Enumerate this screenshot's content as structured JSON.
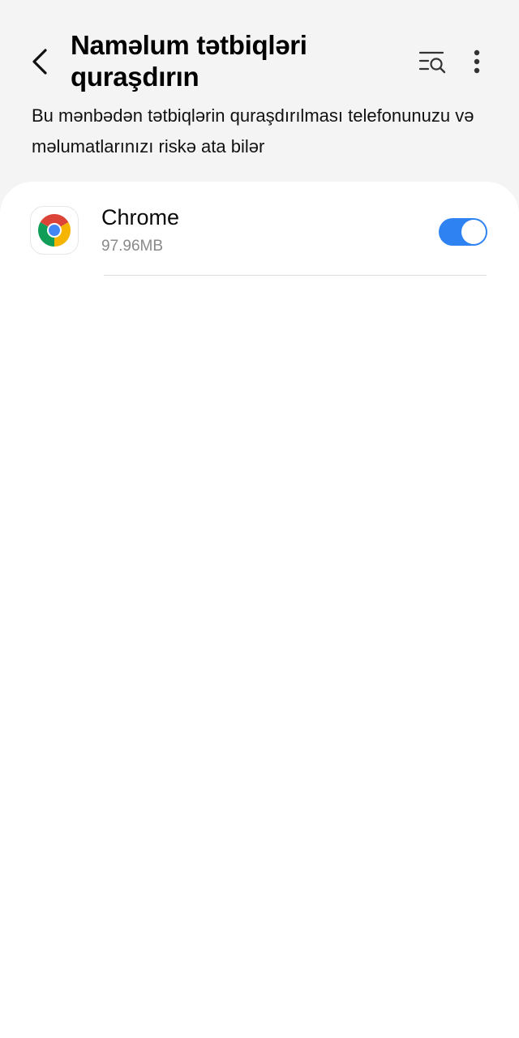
{
  "header": {
    "title": "Naməlum tətbiqləri quraşdırın",
    "description": "Bu mənbədən tətbiqlərin quraşdırılması telefonunuzu və məlumatlarınızı riskə ata bilər",
    "back_icon": "chevron-left-icon",
    "search_icon": "list-search-icon",
    "more_icon": "more-vertical-icon"
  },
  "apps": [
    {
      "name": "Chrome",
      "size": "97.96MB",
      "icon": "chrome-logo-icon",
      "allowed": true
    }
  ],
  "colors": {
    "background": "#f4f4f4",
    "card": "#ffffff",
    "toggle_on": "#2f82f2",
    "secondary_text": "#8a8a8a"
  }
}
